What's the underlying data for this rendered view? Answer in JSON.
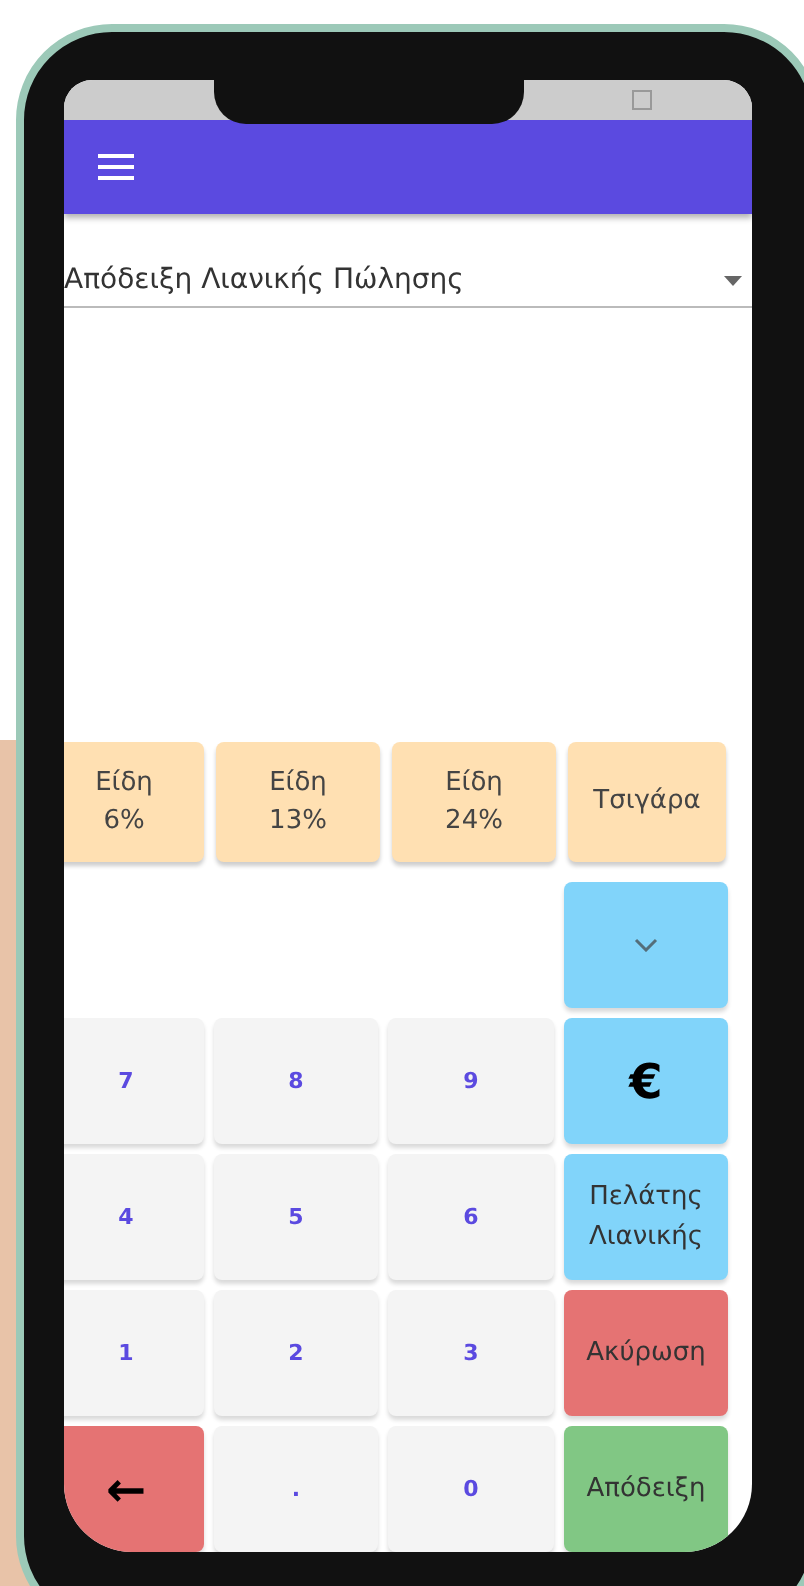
{
  "document_type": {
    "value": "Απόδειξη Λιανικής Πώλησης"
  },
  "categories": [
    {
      "label": "Είδη",
      "sub": "6%"
    },
    {
      "label": "Είδη",
      "sub": "13%"
    },
    {
      "label": "Είδη",
      "sub": "24%"
    },
    {
      "label": "Τσιγάρα"
    }
  ],
  "keypad_rows": [
    {
      "keys": [
        {
          "kind": "collapse",
          "color": "#81d4fa"
        }
      ]
    },
    {
      "keys": [
        {
          "kind": "digit",
          "label": "7"
        },
        {
          "kind": "digit",
          "label": "8"
        },
        {
          "kind": "digit",
          "label": "9"
        },
        {
          "kind": "action",
          "label": "€",
          "color": "#81d4fa"
        }
      ]
    },
    {
      "keys": [
        {
          "kind": "digit",
          "label": "4"
        },
        {
          "kind": "digit",
          "label": "5"
        },
        {
          "kind": "digit",
          "label": "6"
        },
        {
          "kind": "action",
          "label": "Πελάτης Λιανικής",
          "color": "#81d4fa"
        }
      ]
    },
    {
      "keys": [
        {
          "kind": "digit",
          "label": "1"
        },
        {
          "kind": "digit",
          "label": "2"
        },
        {
          "kind": "digit",
          "label": "3"
        },
        {
          "kind": "action",
          "label": "Ακύρωση",
          "color": "#e57373"
        }
      ]
    },
    {
      "keys": [
        {
          "kind": "action",
          "label": "←",
          "color": "#e57373"
        },
        {
          "kind": "digit",
          "label": "."
        },
        {
          "kind": "digit",
          "label": "0"
        },
        {
          "kind": "action",
          "label": "Απόδειξη",
          "color": "#81c784"
        }
      ]
    }
  ]
}
